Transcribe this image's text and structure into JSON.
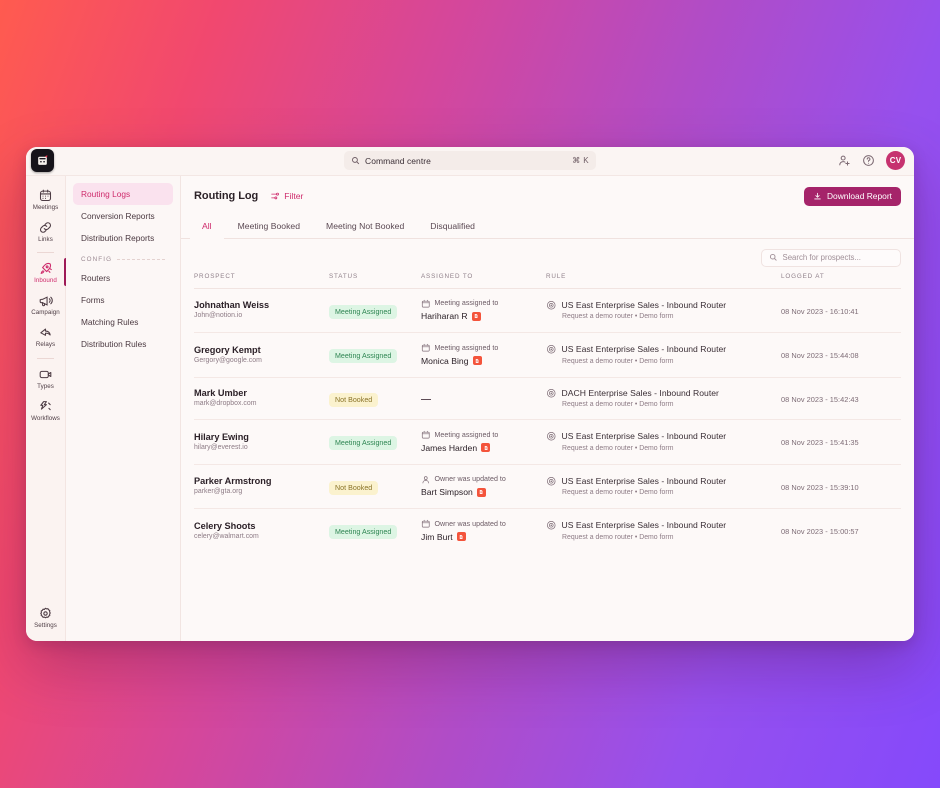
{
  "theme": {
    "bg_gradient_from": "#FF5B4F",
    "bg_gradient_to": "#8549FB",
    "accent": "#CE2A6B",
    "button_primary": "#A5246A",
    "badge_green_bg": "#DDF5E4",
    "badge_green_fg": "#2E8552",
    "badge_yellow_bg": "#FBF2CE",
    "badge_yellow_fg": "#8A7327",
    "crm_badge": "#F4543B",
    "window_bg": "#FDF9F8"
  },
  "topbar": {
    "logo_icon": "app-logo-icon",
    "command": {
      "icon": "search-icon",
      "placeholder": "Command centre",
      "shortcut": "⌘ K"
    },
    "add_user_icon": "add-user-icon",
    "help_icon": "help-circle-icon",
    "avatar_initials": "CV"
  },
  "rail": {
    "items": [
      {
        "label": "Meetings",
        "icon": "calendar-icon",
        "active": false
      },
      {
        "label": "Links",
        "icon": "link-icon",
        "active": false
      },
      {
        "label": "Inbound",
        "icon": "rocket-icon",
        "active": true
      },
      {
        "label": "Campaign",
        "icon": "megaphone-icon",
        "active": false
      },
      {
        "label": "Relays",
        "icon": "relay-icon",
        "active": false
      },
      {
        "label": "Types",
        "icon": "video-icon",
        "active": false
      },
      {
        "label": "Workflows",
        "icon": "workflow-icon",
        "active": false
      }
    ],
    "bottom": {
      "label": "Settings",
      "icon": "gear-icon"
    }
  },
  "subnav": {
    "items": [
      {
        "label": "Routing Logs",
        "active": true
      },
      {
        "label": "Conversion Reports",
        "active": false
      },
      {
        "label": "Distribution Reports",
        "active": false
      }
    ],
    "group_label": "CONFIG",
    "config_items": [
      {
        "label": "Routers",
        "active": false
      },
      {
        "label": "Forms",
        "active": false
      },
      {
        "label": "Matching Rules",
        "active": false
      },
      {
        "label": "Distribution Rules",
        "active": false
      }
    ]
  },
  "main": {
    "title": "Routing Log",
    "filter": {
      "label": "Filter",
      "icon": "filter-icon"
    },
    "download": {
      "label": "Download Report",
      "icon": "download-icon"
    },
    "tabs": [
      {
        "label": "All",
        "active": true
      },
      {
        "label": "Meeting Booked",
        "active": false
      },
      {
        "label": "Meeting Not Booked",
        "active": false
      },
      {
        "label": "Disqualified",
        "active": false
      }
    ],
    "search": {
      "placeholder": "Search for prospects...",
      "value": "",
      "icon": "search-icon"
    },
    "table": {
      "columns": [
        "PROSPECT",
        "STATUS",
        "ASSIGNED TO",
        "RULE",
        "LOGGED AT"
      ],
      "rows": [
        {
          "name": "Johnathan Weiss",
          "email": "John@notion.io",
          "status": "Meeting Assigned",
          "status_type": "green",
          "assigned_icon": "calendar-icon",
          "assigned_label": "Meeting assigned to",
          "assigned_person": "Hariharan R",
          "rule_title": "US East Enterprise Sales - Inbound Router",
          "rule_sub": "Request a demo router • Demo form",
          "logged_at": "08 Nov 2023 - 16:10:41"
        },
        {
          "name": "Gregory Kempt",
          "email": "Gergory@google.com",
          "status": "Meeting Assigned",
          "status_type": "green",
          "assigned_icon": "calendar-icon",
          "assigned_label": "Meeting assigned to",
          "assigned_person": "Monica Bing",
          "rule_title": "US East Enterprise Sales - Inbound Router",
          "rule_sub": "Request a demo router • Demo form",
          "logged_at": "08 Nov 2023 - 15:44:08"
        },
        {
          "name": "Mark Umber",
          "email": "mark@dropbox.com",
          "status": "Not Booked",
          "status_type": "yellow",
          "assigned_icon": "none",
          "assigned_label": "",
          "assigned_person": "—",
          "rule_title": "DACH Enterprise Sales - Inbound Router",
          "rule_sub": "Request a demo router • Demo form",
          "logged_at": "08 Nov 2023 - 15:42:43"
        },
        {
          "name": "Hilary Ewing",
          "email": "hilary@everest.io",
          "status": "Meeting Assigned",
          "status_type": "green",
          "assigned_icon": "calendar-icon",
          "assigned_label": "Meeting assigned to",
          "assigned_person": "James Harden",
          "rule_title": "US East Enterprise Sales - Inbound Router",
          "rule_sub": "Request a demo router • Demo form",
          "logged_at": "08 Nov 2023 - 15:41:35"
        },
        {
          "name": "Parker Armstrong",
          "email": "parker@gta.org",
          "status": "Not Booked",
          "status_type": "yellow",
          "assigned_icon": "person-icon",
          "assigned_label": "Owner was updated to",
          "assigned_person": "Bart Simpson",
          "rule_title": "US East Enterprise Sales - Inbound Router",
          "rule_sub": "Request a demo router • Demo form",
          "logged_at": "08 Nov 2023 - 15:39:10"
        },
        {
          "name": "Celery Shoots",
          "email": "celery@walmart.com",
          "status": "Meeting Assigned",
          "status_type": "green",
          "assigned_icon": "calendar-icon",
          "assigned_label": "Owner was updated to",
          "assigned_person": "Jim Burt",
          "rule_title": "US East Enterprise Sales - Inbound Router",
          "rule_sub": "Request a demo router • Demo form",
          "logged_at": "08 Nov 2023 - 15:00:57"
        }
      ]
    }
  }
}
